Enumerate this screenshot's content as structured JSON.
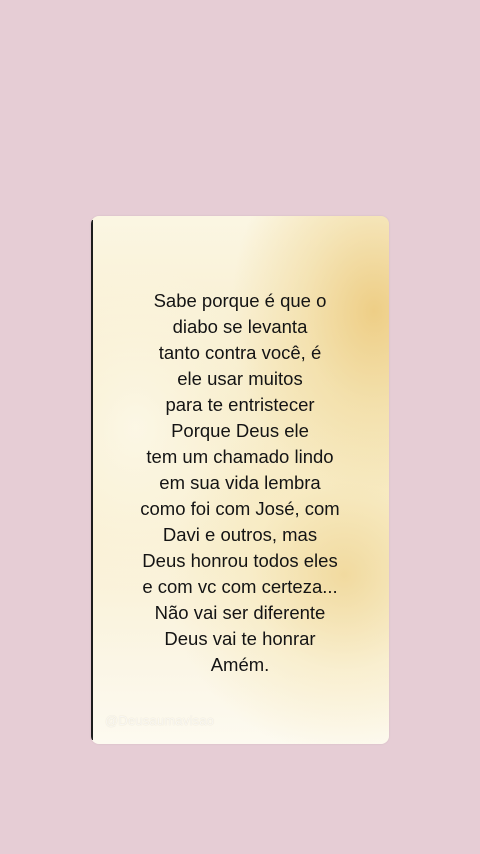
{
  "background_color": "#e6cdd5",
  "card": {
    "lines": [
      "Sabe porque é que o",
      "diabo se levanta",
      "tanto contra você, é",
      "ele usar muitos",
      "para te entristecer",
      "Porque Deus ele",
      "tem um chamado lindo",
      "em sua vida lembra",
      "como foi com José, com",
      "Davi e outros, mas",
      "Deus honrou todos eles",
      "e com vc com certeza...",
      "Não vai ser diferente",
      "Deus vai te honrar",
      "Amém."
    ],
    "watermark": "@Deusaumavisao"
  }
}
